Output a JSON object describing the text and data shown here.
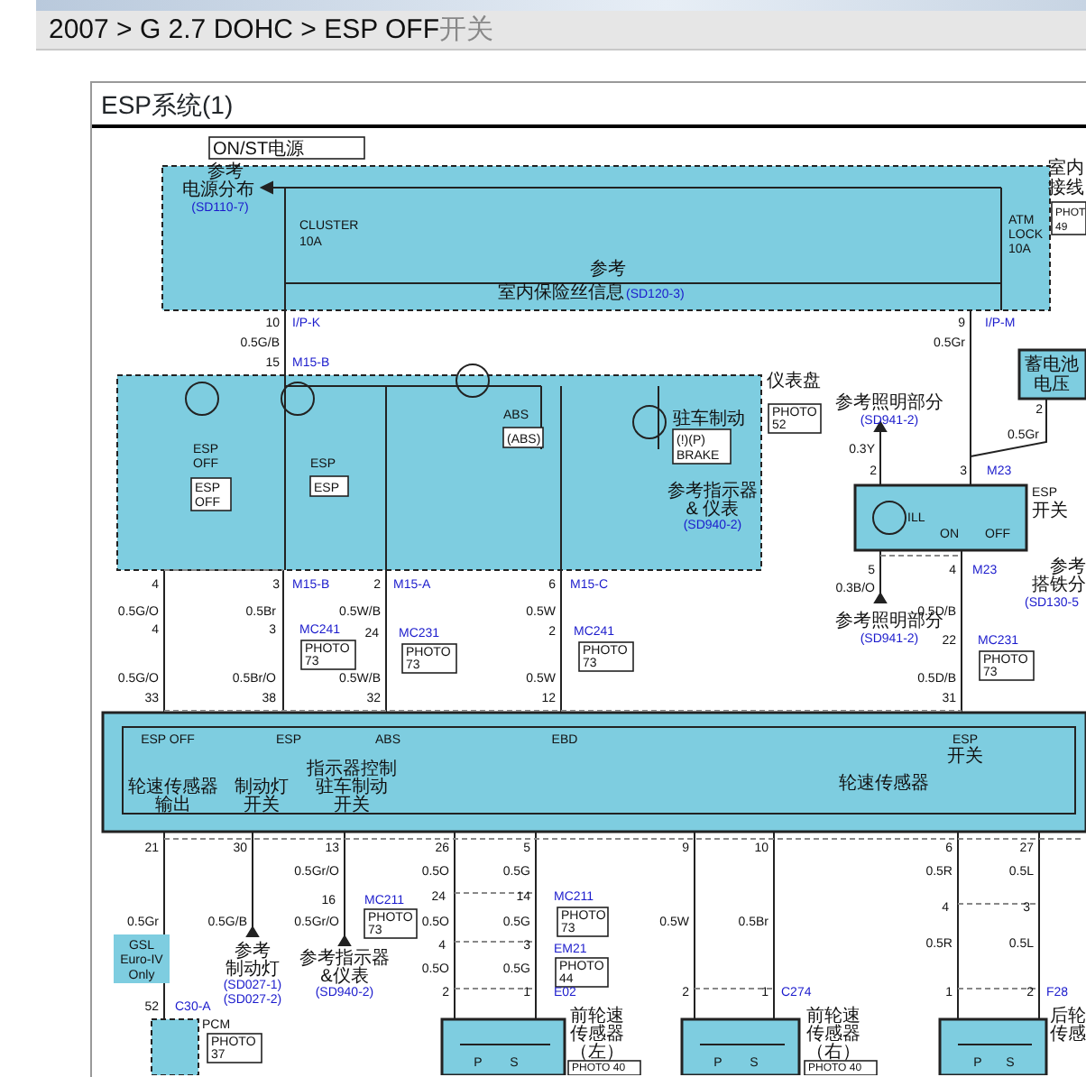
{
  "breadcrumb": {
    "path": "2007 > G 2.7 DOHC > ESP OFF",
    "suffix": "开关"
  },
  "diagram": {
    "title": "ESP系统(1)",
    "labels": [
      {
        "kind": "tag",
        "lines": [
          "ON/ST电源"
        ]
      },
      {
        "kind": "text",
        "text": "参考"
      },
      {
        "kind": "text",
        "text": "电源分布"
      },
      {
        "kind": "ref",
        "text": "(SD110-7)"
      },
      {
        "kind": "text",
        "text": "CLUSTER"
      },
      {
        "kind": "text",
        "text": "10A"
      },
      {
        "kind": "text",
        "text": "ATM"
      },
      {
        "kind": "text",
        "text": "LOCK"
      },
      {
        "kind": "text",
        "text": "10A"
      },
      {
        "kind": "text",
        "text": "参考"
      },
      {
        "kind": "text",
        "text": "室内保险丝信息"
      },
      {
        "kind": "ref",
        "text": "(SD120-3)"
      },
      {
        "kind": "text",
        "text": "室内"
      },
      {
        "kind": "text",
        "text": "接线"
      },
      {
        "kind": "tag",
        "lines": [
          "PHOT",
          "49"
        ]
      },
      {
        "kind": "text",
        "text": "10"
      },
      {
        "kind": "ref",
        "text": "I/P-K"
      },
      {
        "kind": "text",
        "text": "0.5G/B"
      },
      {
        "kind": "text",
        "text": "9"
      },
      {
        "kind": "ref",
        "text": "I/P-M"
      },
      {
        "kind": "text",
        "text": "0.5Gr"
      },
      {
        "kind": "text",
        "text": "15"
      },
      {
        "kind": "ref",
        "text": "M15-B"
      },
      {
        "kind": "text",
        "text": "ESP"
      },
      {
        "kind": "text",
        "text": "OFF"
      },
      {
        "kind": "tag",
        "lines": [
          "ESP",
          "OFF"
        ]
      },
      {
        "kind": "text",
        "text": "ESP"
      },
      {
        "kind": "tag",
        "lines": [
          "ESP"
        ]
      },
      {
        "kind": "text",
        "text": "ABS"
      },
      {
        "kind": "tag",
        "lines": [
          "(ABS)"
        ]
      },
      {
        "kind": "text",
        "text": "驻车制动"
      },
      {
        "kind": "tag",
        "lines": [
          "(!)(P)",
          "BRAKE"
        ]
      },
      {
        "kind": "text",
        "text": "参考指示器"
      },
      {
        "kind": "text",
        "text": "& 仪表"
      },
      {
        "kind": "ref",
        "text": "(SD940-2)"
      },
      {
        "kind": "text",
        "text": "仪表盘"
      },
      {
        "kind": "tag",
        "lines": [
          "PHOTO",
          "52"
        ]
      },
      {
        "kind": "text",
        "text": "参考照明部分"
      },
      {
        "kind": "ref",
        "text": "(SD941-2)"
      },
      {
        "kind": "text",
        "text": "0.3Y"
      },
      {
        "kind": "text",
        "text": "2"
      },
      {
        "kind": "text",
        "text": "3"
      },
      {
        "kind": "ref",
        "text": "M23"
      },
      {
        "kind": "text",
        "text": "蓄电池"
      },
      {
        "kind": "text",
        "text": "电压"
      },
      {
        "kind": "text",
        "text": "2"
      },
      {
        "kind": "text",
        "text": "0.5Gr"
      },
      {
        "kind": "text",
        "text": "ILL"
      },
      {
        "kind": "text",
        "text": "ON"
      },
      {
        "kind": "text",
        "text": "OFF"
      },
      {
        "kind": "text",
        "text": "ESP"
      },
      {
        "kind": "text",
        "text": "开关"
      },
      {
        "kind": "text",
        "text": "4"
      },
      {
        "kind": "text",
        "text": "3"
      },
      {
        "kind": "ref",
        "text": "M15-B"
      },
      {
        "kind": "text",
        "text": "2"
      },
      {
        "kind": "ref",
        "text": "M15-A"
      },
      {
        "kind": "text",
        "text": "6"
      },
      {
        "kind": "ref",
        "text": "M15-C"
      },
      {
        "kind": "text",
        "text": "5"
      },
      {
        "kind": "text",
        "text": "4"
      },
      {
        "kind": "ref",
        "text": "M23"
      },
      {
        "kind": "text",
        "text": "0.5G/O"
      },
      {
        "kind": "text",
        "text": "0.5Br"
      },
      {
        "kind": "text",
        "text": "0.5W/B"
      },
      {
        "kind": "text",
        "text": "0.5W"
      },
      {
        "kind": "text",
        "text": "0.3B/O"
      },
      {
        "kind": "text",
        "text": "0.5D/B"
      },
      {
        "kind": "text",
        "text": "参考照明部分"
      },
      {
        "kind": "ref",
        "text": "(SD941-2)"
      },
      {
        "kind": "text",
        "text": "参考"
      },
      {
        "kind": "text",
        "text": "搭铁分"
      },
      {
        "kind": "ref",
        "text": "(SD130-5"
      },
      {
        "kind": "text",
        "text": "4"
      },
      {
        "kind": "text",
        "text": "3"
      },
      {
        "kind": "ref",
        "text": "MC241"
      },
      {
        "kind": "tag",
        "lines": [
          "PHOTO",
          "73"
        ]
      },
      {
        "kind": "text",
        "text": "24"
      },
      {
        "kind": "ref",
        "text": "MC231"
      },
      {
        "kind": "tag",
        "lines": [
          "PHOTO",
          "73"
        ]
      },
      {
        "kind": "text",
        "text": "2"
      },
      {
        "kind": "ref",
        "text": "MC241"
      },
      {
        "kind": "tag",
        "lines": [
          "PHOTO",
          "73"
        ]
      },
      {
        "kind": "text",
        "text": "22"
      },
      {
        "kind": "ref",
        "text": "MC231"
      },
      {
        "kind": "tag",
        "lines": [
          "PHOTO",
          "73"
        ]
      },
      {
        "kind": "text",
        "text": "0.5G/O"
      },
      {
        "kind": "text",
        "text": "0.5Br/O"
      },
      {
        "kind": "text",
        "text": "0.5W/B"
      },
      {
        "kind": "text",
        "text": "0.5W"
      },
      {
        "kind": "text",
        "text": "0.5D/B"
      },
      {
        "kind": "text",
        "text": "33"
      },
      {
        "kind": "text",
        "text": "38"
      },
      {
        "kind": "text",
        "text": "32"
      },
      {
        "kind": "text",
        "text": "12"
      },
      {
        "kind": "text",
        "text": "31"
      },
      {
        "kind": "text",
        "text": "ESP OFF"
      },
      {
        "kind": "text",
        "text": "ESP"
      },
      {
        "kind": "text",
        "text": "ABS"
      },
      {
        "kind": "text",
        "text": "EBD"
      },
      {
        "kind": "text",
        "text": "ESP"
      },
      {
        "kind": "text",
        "text": "开关"
      },
      {
        "kind": "text",
        "text": "指示器控制"
      },
      {
        "kind": "text",
        "text": "驻车制动"
      },
      {
        "kind": "text",
        "text": "开关"
      },
      {
        "kind": "text",
        "text": "轮速传感器"
      },
      {
        "kind": "text",
        "text": "输出"
      },
      {
        "kind": "text",
        "text": "制动灯"
      },
      {
        "kind": "text",
        "text": "开关"
      },
      {
        "kind": "text",
        "text": "轮速传感器"
      },
      {
        "kind": "text",
        "text": "21"
      },
      {
        "kind": "text",
        "text": "30"
      },
      {
        "kind": "text",
        "text": "13"
      },
      {
        "kind": "text",
        "text": "26"
      },
      {
        "kind": "text",
        "text": "5"
      },
      {
        "kind": "text",
        "text": "9"
      },
      {
        "kind": "text",
        "text": "10"
      },
      {
        "kind": "text",
        "text": "6"
      },
      {
        "kind": "text",
        "text": "27"
      },
      {
        "kind": "text",
        "text": "0.5Gr/O"
      },
      {
        "kind": "text",
        "text": "0.5O"
      },
      {
        "kind": "text",
        "text": "0.5G"
      },
      {
        "kind": "text",
        "text": "0.5R"
      },
      {
        "kind": "text",
        "text": "0.5L"
      },
      {
        "kind": "text",
        "text": "0.5Gr"
      },
      {
        "kind": "text",
        "text": "0.5G/B"
      },
      {
        "kind": "text",
        "text": "16"
      },
      {
        "kind": "text",
        "text": "0.5Gr/O"
      },
      {
        "kind": "ref",
        "text": "MC211"
      },
      {
        "kind": "tag",
        "lines": [
          "PHOTO",
          "73"
        ]
      },
      {
        "kind": "text",
        "text": "24"
      },
      {
        "kind": "text",
        "text": "0.5O"
      },
      {
        "kind": "text",
        "text": "14"
      },
      {
        "kind": "text",
        "text": "0.5G"
      },
      {
        "kind": "ref",
        "text": "MC211"
      },
      {
        "kind": "tag",
        "lines": [
          "PHOTO",
          "73"
        ]
      },
      {
        "kind": "text",
        "text": "0.5W"
      },
      {
        "kind": "text",
        "text": "0.5Br"
      },
      {
        "kind": "note",
        "lines": [
          "GSL",
          "Euro-IV",
          "Only"
        ]
      },
      {
        "kind": "text",
        "text": "参考"
      },
      {
        "kind": "text",
        "text": "制动灯"
      },
      {
        "kind": "ref",
        "text": "(SD027-1)"
      },
      {
        "kind": "ref",
        "text": "(SD027-2)"
      },
      {
        "kind": "text",
        "text": "参考指示器"
      },
      {
        "kind": "text",
        "text": "&仪表"
      },
      {
        "kind": "ref",
        "text": "(SD940-2)"
      },
      {
        "kind": "text",
        "text": "4"
      },
      {
        "kind": "text",
        "text": "3"
      },
      {
        "kind": "ref",
        "text": "EM21"
      },
      {
        "kind": "tag",
        "lines": [
          "PHOTO",
          "44"
        ]
      },
      {
        "kind": "text",
        "text": "4"
      },
      {
        "kind": "text",
        "text": "3"
      },
      {
        "kind": "text",
        "text": "0.5O"
      },
      {
        "kind": "text",
        "text": "0.5G"
      },
      {
        "kind": "text",
        "text": "0.5R"
      },
      {
        "kind": "text",
        "text": "0.5L"
      },
      {
        "kind": "text",
        "text": "2"
      },
      {
        "kind": "text",
        "text": "1"
      },
      {
        "kind": "ref",
        "text": "E02"
      },
      {
        "kind": "text",
        "text": "2"
      },
      {
        "kind": "text",
        "text": "1"
      },
      {
        "kind": "ref",
        "text": "C274"
      },
      {
        "kind": "text",
        "text": "1"
      },
      {
        "kind": "text",
        "text": "2"
      },
      {
        "kind": "ref",
        "text": "F28"
      },
      {
        "kind": "text",
        "text": "52"
      },
      {
        "kind": "ref",
        "text": "C30-A"
      },
      {
        "kind": "text",
        "text": "PCM"
      },
      {
        "kind": "tag",
        "lines": [
          "PHOTO",
          "37"
        ]
      },
      {
        "kind": "text",
        "text": "前轮速"
      },
      {
        "kind": "text",
        "text": "传感器"
      },
      {
        "kind": "text",
        "text": "（左）"
      },
      {
        "kind": "tag",
        "lines": [
          "PHOTO 40"
        ]
      },
      {
        "kind": "text",
        "text": "前轮速"
      },
      {
        "kind": "text",
        "text": "传感器"
      },
      {
        "kind": "text",
        "text": "（右）"
      },
      {
        "kind": "tag",
        "lines": [
          "PHOTO 40"
        ]
      },
      {
        "kind": "text",
        "text": "后轮"
      },
      {
        "kind": "text",
        "text": "传感"
      },
      {
        "kind": "text",
        "text": "P"
      },
      {
        "kind": "text",
        "text": "S"
      },
      {
        "kind": "text",
        "text": "P"
      },
      {
        "kind": "text",
        "text": "S"
      },
      {
        "kind": "text",
        "text": "P"
      },
      {
        "kind": "text",
        "text": "S"
      }
    ]
  }
}
